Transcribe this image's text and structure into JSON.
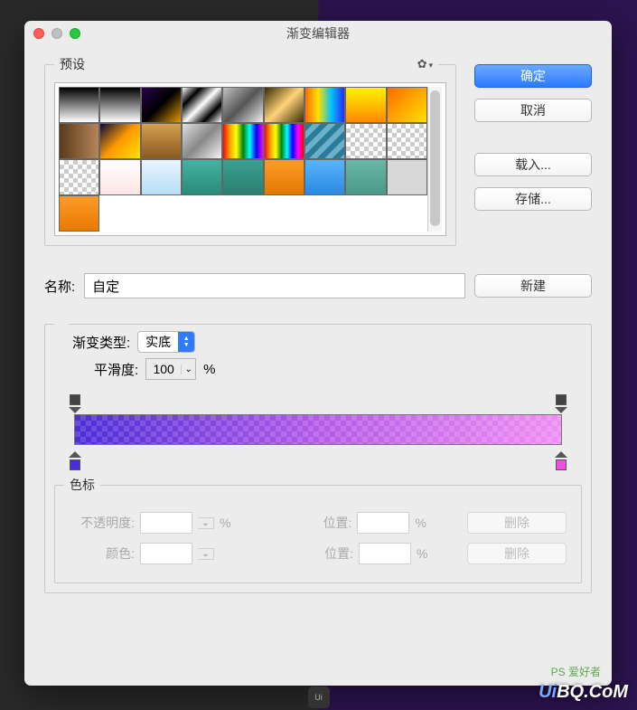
{
  "window": {
    "title": "渐变编辑器"
  },
  "presets": {
    "legend": "预设",
    "gear": "gear",
    "swatches": [
      {
        "g": "linear-gradient(180deg,#000,#fff)"
      },
      {
        "g": "linear-gradient(180deg,#000,transparent)",
        "ck": true
      },
      {
        "g": "linear-gradient(135deg,#2a004f,#000,#e89b00)"
      },
      {
        "g": "linear-gradient(135deg,#fff,#000,#fff,#000,#fff)"
      },
      {
        "g": "linear-gradient(135deg,#c0c0c0,#555,#eee)"
      },
      {
        "g": "linear-gradient(135deg,#3a2a00,#ffd37a,#3a2a00)"
      },
      {
        "g": "linear-gradient(90deg,#ff6a00,#ffe100,#00c2ff,#2a2aff)"
      },
      {
        "g": "linear-gradient(180deg,#fff100,#ff8a00)"
      },
      {
        "g": "linear-gradient(135deg,#ff6a00,#ffe100)"
      },
      {
        "g": "linear-gradient(90deg,#5b3a1a,#b5855a)"
      },
      {
        "g": "linear-gradient(135deg,#0a0a3a,#ff9a00,#ffe100)"
      },
      {
        "g": "linear-gradient(180deg,#d4a050,#8a5a20)"
      },
      {
        "g": "linear-gradient(135deg,#e0e0e0,#888,#f4f4f4)"
      },
      {
        "g": "linear-gradient(90deg,red,orange,yellow,green,cyan,blue,magenta)"
      },
      {
        "g": "linear-gradient(90deg,red,orange,yellow,green,cyan,blue,magenta,red)"
      },
      {
        "g": "repeating-linear-gradient(135deg,#2a7a9a 0 6px,#6ab0c8 6px 12px)"
      },
      {
        "g": "",
        "ck": true
      },
      {
        "g": "",
        "ck": true
      },
      {
        "g": "",
        "ck": true
      },
      {
        "g": "linear-gradient(180deg,#fff,#ffe4e4)"
      },
      {
        "g": "linear-gradient(180deg,#e8f4ff,#b8ddf5)"
      },
      {
        "g": "linear-gradient(180deg,#44b3a0,#2a8a78)"
      },
      {
        "g": "linear-gradient(180deg,#3aa090,#2a8070)"
      },
      {
        "g": "linear-gradient(180deg,#ff9a2a,#e07a00)"
      },
      {
        "g": "linear-gradient(180deg,#5ab4ff,#2a8ae0)"
      },
      {
        "g": "linear-gradient(180deg,#6ab8a8,#4a9888)"
      },
      {
        "g": "#d8d8d8"
      },
      {
        "g": "linear-gradient(180deg,#ff9a2a,#e87a00)"
      }
    ]
  },
  "buttons": {
    "ok": "确定",
    "cancel": "取消",
    "load": "载入...",
    "save": "存储...",
    "new": "新建"
  },
  "name": {
    "label": "名称:",
    "value": "自定"
  },
  "gradient": {
    "type_label": "渐变类型:",
    "type_value": "实底",
    "smooth_label": "平滑度:",
    "smooth_value": "100",
    "smooth_unit": "%",
    "start_color": "#4b2dd8",
    "end_color": "#ef4fe0"
  },
  "stops": {
    "legend": "色标",
    "opacity_label": "不透明度:",
    "opacity_unit": "%",
    "pos_label": "位置:",
    "pos_unit": "%",
    "color_label": "颜色:",
    "delete": "删除"
  },
  "watermark": {
    "text": "UiBQ.CoM",
    "small": "PS 爱好者"
  }
}
